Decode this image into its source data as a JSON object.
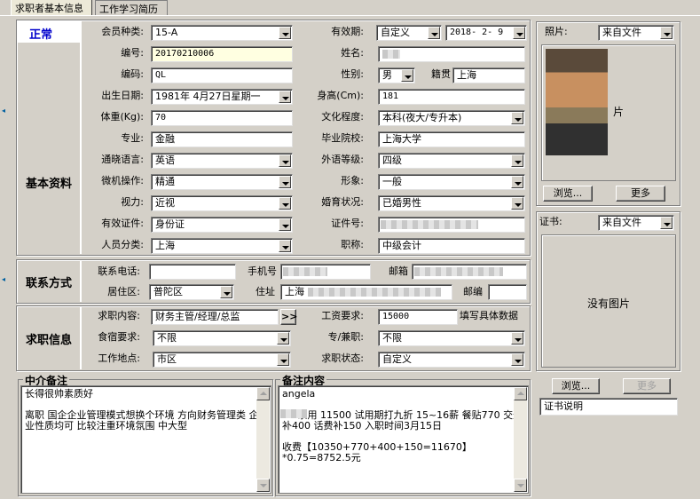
{
  "tabs": [
    "求职者基本信息",
    "工作学习简历"
  ],
  "status": "正常",
  "sections": {
    "basic": "基本资料",
    "contact": "联系方式",
    "job": "求职信息"
  },
  "fields": {
    "member_type": {
      "label": "会员种类:",
      "value": "15-A"
    },
    "validity": {
      "label": "有效期:",
      "value": "自定义",
      "date": "2018- 2- 9"
    },
    "number": {
      "label": "编号:",
      "value": "20170210006"
    },
    "name": {
      "label": "姓名:"
    },
    "code": {
      "label": "编码:",
      "value": "QL"
    },
    "gender": {
      "label": "性别:",
      "value": "男"
    },
    "native": {
      "label": "籍贯",
      "value": "上海"
    },
    "birth": {
      "label": "出生日期:",
      "value": "1981年 4月27日星期一"
    },
    "height": {
      "label": "身高(Cm):",
      "value": "181"
    },
    "weight": {
      "label": "体重(Kg):",
      "value": "70"
    },
    "education": {
      "label": "文化程度:",
      "value": "本科(夜大/专升本)"
    },
    "major": {
      "label": "专业:",
      "value": "金融"
    },
    "school": {
      "label": "毕业院校:",
      "value": "上海大学"
    },
    "language": {
      "label": "通晓语言:",
      "value": "英语"
    },
    "foreign_level": {
      "label": "外语等级:",
      "value": "四级"
    },
    "computer": {
      "label": "微机操作:",
      "value": "精通"
    },
    "appearance": {
      "label": "形象:",
      "value": "一般"
    },
    "vision": {
      "label": "视力:",
      "value": "近视"
    },
    "marital": {
      "label": "婚育状况:",
      "value": "已婚男性"
    },
    "id_type": {
      "label": "有效证件:",
      "value": "身份证"
    },
    "id_number": {
      "label": "证件号:"
    },
    "person_type": {
      "label": "人员分类:",
      "value": "上海"
    },
    "title": {
      "label": "职称:",
      "value": "中级会计"
    },
    "phone": {
      "label": "联系电话:"
    },
    "mobile": {
      "label": "手机号"
    },
    "email": {
      "label": "邮箱"
    },
    "district": {
      "label": "居住区:",
      "value": "普陀区"
    },
    "address": {
      "label": "住址",
      "value": "上海"
    },
    "postcode": {
      "label": "邮编"
    },
    "job_content": {
      "label": "求职内容:",
      "value": "财务主管/经理/总监",
      "more": ">>"
    },
    "salary": {
      "label": "工资要求:",
      "value": "15000",
      "hint": "填写具体数据"
    },
    "lodging": {
      "label": "食宿要求:",
      "value": "不限"
    },
    "fulltime": {
      "label": "专/兼职:",
      "value": "不限"
    },
    "location": {
      "label": "工作地点:",
      "value": "市区"
    },
    "job_status": {
      "label": "求职状态:",
      "value": "自定义"
    }
  },
  "notes": {
    "agency_title": "中介备注",
    "agency_text": "长得很帅素质好\n\n离职 国企企业管理模式想换个环境 方向财务管理类 企业性质均可 比较注重环境氛围 中大型",
    "remark_title": "备注内容",
    "remark_text": "angela\n\n     录用 11500 试用期打九折 15~16薪 餐贴770 交通补400 话费补150 入职时间3月15日\n\n收费【10350+770+400+150=11670】*0.75=8752.5元"
  },
  "photo": {
    "label": "照片:",
    "source": "来自文件",
    "partial_text": "片",
    "browse": "浏览...",
    "more": "更多"
  },
  "cert": {
    "label": "证书:",
    "source": "来自文件",
    "empty": "没有图片",
    "browse": "浏览...",
    "more": "更多",
    "desc": "证书说明"
  }
}
